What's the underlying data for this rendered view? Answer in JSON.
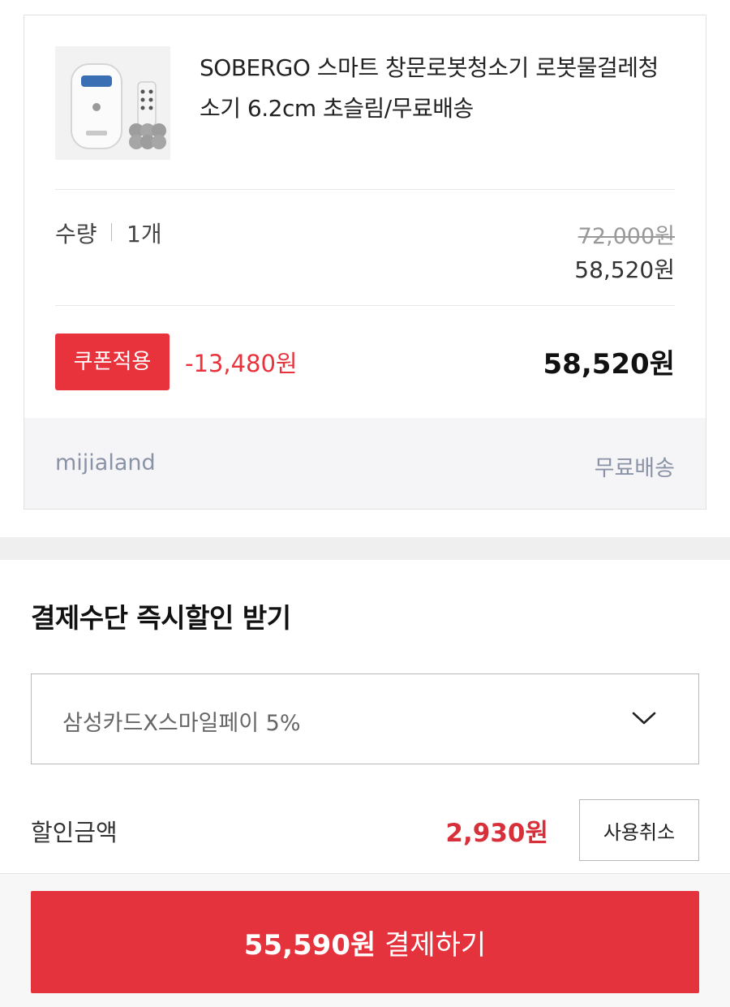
{
  "product": {
    "image_icon": "robot-window-cleaner-image",
    "title": "SOBERGO 스마트 창문로봇청소기 로봇물걸레청소기 6.2cm 초슬림/무료배송",
    "quantity_label": "수량",
    "quantity_value": "1개",
    "original_price": "72,000원",
    "sale_price": "58,520원",
    "coupon_button_label": "쿠폰적용",
    "coupon_discount": "-13,480원",
    "final_price": "58,520원",
    "seller_name": "mijialand",
    "shipping": "무료배송"
  },
  "payment_discount": {
    "section_title": "결제수단 즉시할인 받기",
    "selected_option": "삼성카드X스마일페이 5%",
    "discount_label": "할인금액",
    "discount_amount": "2,930원",
    "cancel_button_label": "사용취소"
  },
  "checkout": {
    "amount": "55,590원",
    "action_label": "결제하기"
  },
  "colors": {
    "accent_red": "#e5333d",
    "discount_red": "#d8303a",
    "muted_text": "#8a93a6"
  }
}
